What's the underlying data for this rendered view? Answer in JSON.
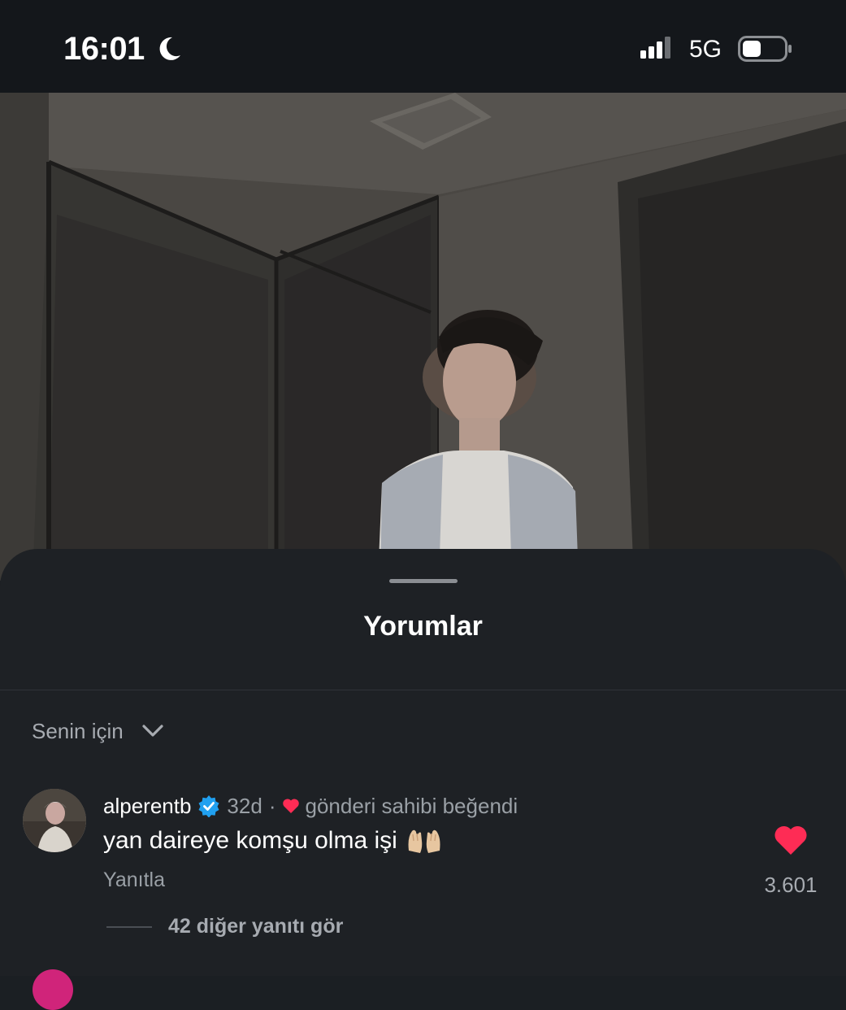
{
  "status_bar": {
    "time": "16:01",
    "network": "5G",
    "icons": [
      "moon-icon",
      "signal-icon",
      "battery-icon"
    ]
  },
  "comments_sheet": {
    "title": "Yorumlar",
    "sort": {
      "label": "Senin için",
      "icon": "chevron-down-icon"
    },
    "comments": [
      {
        "username": "alperentb",
        "verified": true,
        "age": "32d",
        "separator": "·",
        "liked_by_creator": "gönderi sahibi beğendi",
        "text": "yan daireye komşu olma işi",
        "emoji": "🙌🏼",
        "reply_label": "Yanıtla",
        "like_count": "3.601",
        "liked": true,
        "view_replies": "42 diğer yanıtı gör"
      }
    ]
  },
  "colors": {
    "sheet_background": "#1e2125",
    "heart": "#fe2c55",
    "verified": "#20a0f0",
    "secondary_text": "#9aa0a6"
  }
}
